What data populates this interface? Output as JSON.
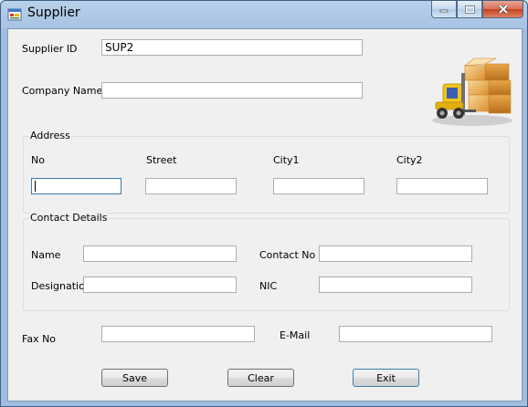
{
  "window": {
    "title": "Supplier"
  },
  "form": {
    "supplier_id_label": "Supplier ID",
    "supplier_id_value": "SUP2",
    "company_name_label": "Company Name",
    "company_name_value": ""
  },
  "address": {
    "title": "Address",
    "no_label": "No",
    "street_label": "Street",
    "city1_label": "City1",
    "city2_label": "City2"
  },
  "contact": {
    "title": "Contact Details",
    "name_label": "Name",
    "contact_no_label": "Contact No",
    "designation_label": "Designation",
    "nic_label": "NIC"
  },
  "extra": {
    "fax_label": "Fax No",
    "email_label": "E-Mail"
  },
  "buttons": {
    "save": "Save",
    "clear": "Clear",
    "exit": "Exit"
  },
  "icons": {
    "app": "app-form-icon",
    "picture": "forklift-boxes-icon"
  },
  "colors": {
    "titlebar": "#a8c3e2",
    "client": "#f0f0f0",
    "close": "#c2411f"
  }
}
